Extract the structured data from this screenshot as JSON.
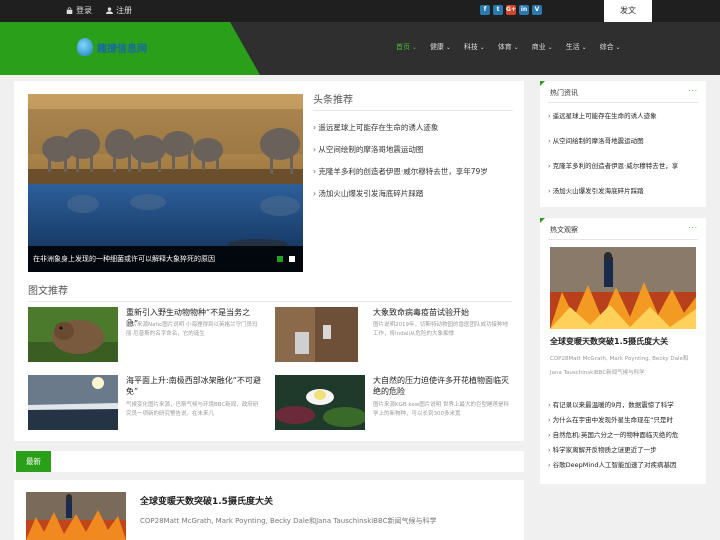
{
  "topbar": {
    "login": "登录",
    "register": "注册",
    "post": "发文",
    "social": [
      {
        "icon": "facebook-icon",
        "glyph": "f"
      },
      {
        "icon": "twitter-icon",
        "glyph": "t"
      },
      {
        "icon": "googleplus-icon",
        "glyph": "G+"
      },
      {
        "icon": "linkedin-icon",
        "glyph": "in"
      },
      {
        "icon": "vimeo-icon",
        "glyph": "V"
      }
    ]
  },
  "header": {
    "site_name": "趣撩信息网",
    "nav": [
      "首页",
      "健康",
      "科技",
      "体育",
      "商业",
      "生活",
      "综合"
    ],
    "active_index": 0
  },
  "headline": {
    "title": "头条推荐",
    "items": [
      "遥远星球上可能存在生命的诱人迹象",
      "从空间绘制的摩洛哥地震运动图",
      "克隆羊多利的创造者伊恩·威尔穆特去世，享年79岁",
      "汤加火山爆发引发海底碎片踩踏"
    ],
    "slide_caption": "在非洲象身上发现的一种细菌或许可以解释大象猝死的原因"
  },
  "picture_recs": {
    "title": "图文推荐",
    "items": [
      {
        "title": "重新引入野生动物物种“不是当务之急”",
        "desc": "图片来源Natic图片说明 小海狸得到以英格兰守门员玛丽·厄普斯的名字命名，它的诞生"
      },
      {
        "title": "大象致命病毒疫苗试验开始",
        "desc": "图片说明2019年，切斯特动物园的兽医团队成功接种地工作，将Indali从危险的大象痴悸"
      },
      {
        "title": "海平面上升:南极西部冰架融化“不可避免”",
        "desc": "气候变化图片来源，巴斯气候与环境BBC新闻，政府研究员一项新的研究警告说，在未来几"
      },
      {
        "title": "大自然的压力迫使许多开花植物面临灭绝的危险",
        "desc": "图片来源KGB kew图片说明 世界上最大的巨型睡莲是科学上的新物种，可以长到300多米宽"
      }
    ]
  },
  "latest": {
    "label": "最新",
    "title": "全球变暖天数突破1.5摄氏度大关",
    "desc": "COP28Matt McGrath, Mark Poynting, Becky Dale和Jana TauschinskiBBC新闻气候与科学"
  },
  "sidebar": {
    "hot_news": {
      "title": "热门资讯",
      "more": "···",
      "items": [
        "遥远星球上可能存在生命的诱人迹象",
        "从空间绘制的摩洛哥地震运动图",
        "克隆羊多利的创造者伊恩·威尔穆特去世，享",
        "汤加火山爆发引发海底碎片踩踏"
      ]
    },
    "hot_watch": {
      "title": "热文观察",
      "more": "···",
      "feature_title": "全球变暖天数突破1.5摄氏度大关",
      "feature_desc": "COP28Matt McGrath, Mark Poynting, Becky Dale和Jana TauschinskiBBC新闻气候与科学",
      "items": [
        "有记录以来最温暖的9月，数据震惊了科学",
        "为什么在宇宙中发现外星生命现在“只是时",
        "自然危机:英国六分之一的物种面临灭绝的危",
        "科学家离解开反物质之谜更近了一步",
        "谷歌DeepMind人工智能加速了对疾病基因"
      ]
    }
  },
  "colors": {
    "accent": "#2aa01a",
    "dark": "#2f2f2f"
  }
}
